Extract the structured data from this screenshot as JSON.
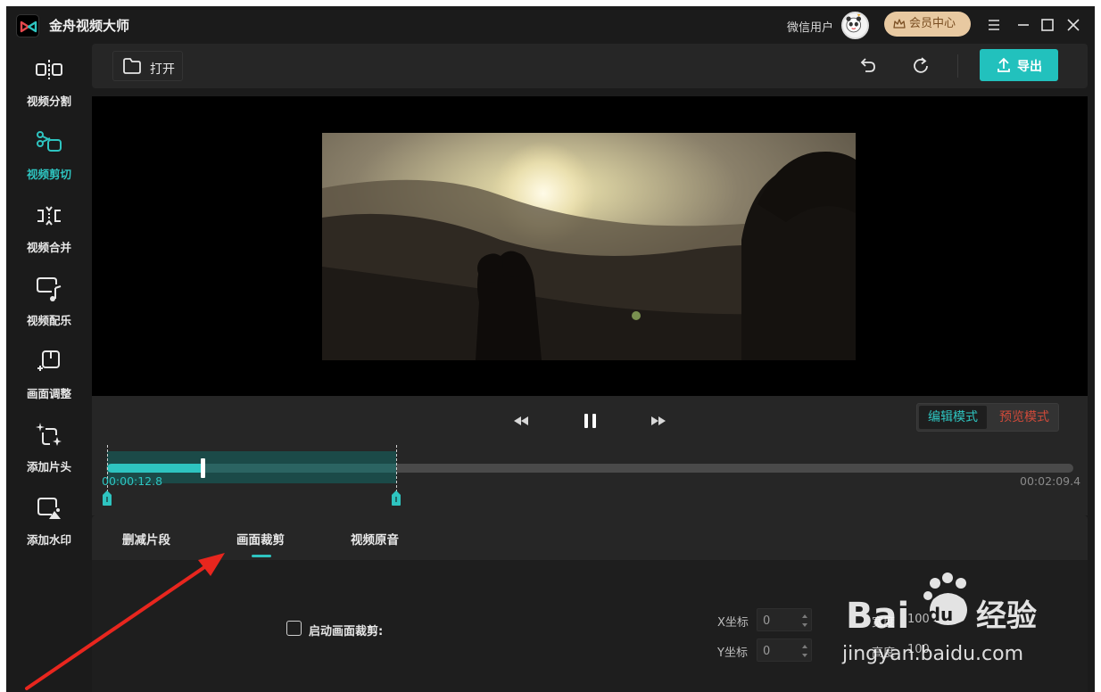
{
  "app": {
    "title": "金舟视频大师",
    "user_name": "微信用户",
    "vip_label": "会员中心"
  },
  "sidebar": {
    "items": [
      {
        "label": "视频分割",
        "icon": "split-icon",
        "active": false
      },
      {
        "label": "视频剪切",
        "icon": "scissors-icon",
        "active": true
      },
      {
        "label": "视频合并",
        "icon": "merge-icon",
        "active": false
      },
      {
        "label": "视频配乐",
        "icon": "music-icon",
        "active": false
      },
      {
        "label": "画面调整",
        "icon": "adjust-icon",
        "active": false
      },
      {
        "label": "添加片头",
        "icon": "sparkle-icon",
        "active": false
      },
      {
        "label": "添加水印",
        "icon": "watermark-icon",
        "active": false
      }
    ]
  },
  "toolbar": {
    "open_label": "打开",
    "export_label": "导出"
  },
  "player": {
    "mode_edit": "编辑模式",
    "mode_preview": "预览模式",
    "current_time": "00:00:12.8",
    "total_time": "00:02:09.4"
  },
  "tabs": {
    "items": [
      "删减片段",
      "画面裁剪",
      "视频原音"
    ],
    "active_index": 1
  },
  "crop": {
    "enable_label": "启动画面裁剪:",
    "x_label": "X坐标",
    "x_value": "0",
    "y_label": "Y坐标",
    "y_value": "0",
    "width_label": "宽度",
    "width_value": "100",
    "height_label": "高度",
    "height_value": "100"
  },
  "watermark": {
    "brand": "Baidu",
    "brand_cn": "经验",
    "url": "jingyan.baidu.com"
  },
  "colors": {
    "accent": "#2ec4c0",
    "export": "#22c1bd",
    "preview_mode": "#d04a3a",
    "vip": "#e8c9a1"
  }
}
